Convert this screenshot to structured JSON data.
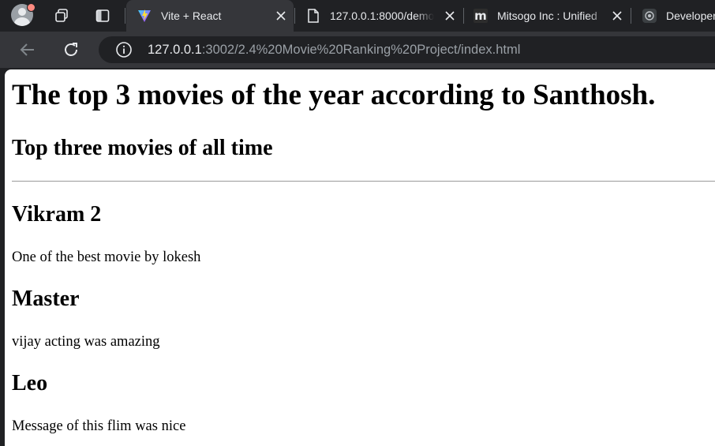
{
  "browser": {
    "tabs": [
      {
        "title": "Vite + React",
        "icon": "vite-icon",
        "active": true
      },
      {
        "title": "127.0.0.1:8000/demo",
        "icon": "document-icon",
        "active": false
      },
      {
        "title": "Mitsogo Inc : Unified",
        "icon": "mitsogo-m-icon",
        "active": false
      },
      {
        "title": "Developer",
        "icon": "openai-icon",
        "active": false
      }
    ],
    "url_host": "127.0.0.1",
    "url_rest": ":3002/2.4%20Movie%20Ranking%20Project/index.html",
    "theme": {
      "frame": "#202124",
      "toolbar": "#35363a",
      "text": "#e8eaed"
    }
  },
  "page": {
    "heading": "The top 3 movies of the year according to Santhosh.",
    "subheading": "Top three movies of all time",
    "movies": [
      {
        "title": "Vikram 2",
        "description": "One of the best movie by lokesh"
      },
      {
        "title": "Master",
        "description": "vijay acting was amazing"
      },
      {
        "title": "Leo",
        "description": "Message of this flim was nice"
      }
    ]
  }
}
